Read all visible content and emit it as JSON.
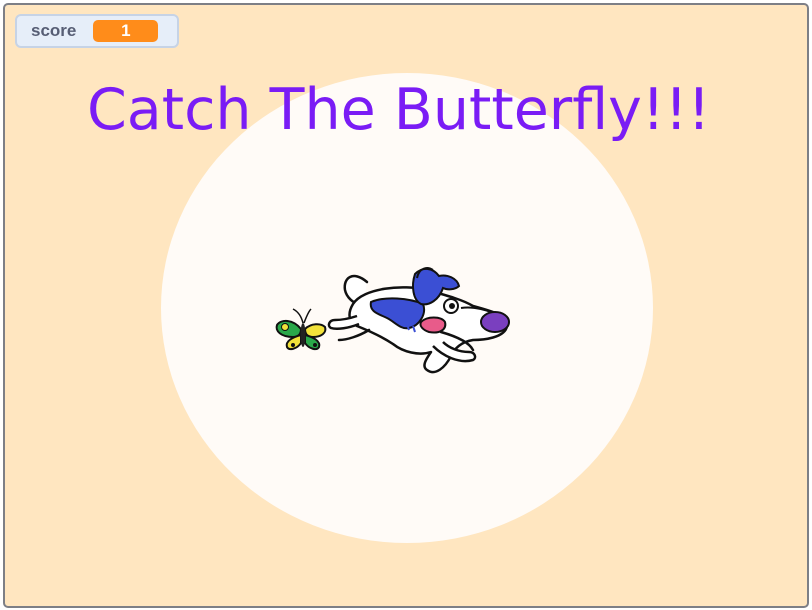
{
  "score_monitor": {
    "label": "score",
    "value": "1"
  },
  "title": "Catch The Butterfly!!!",
  "sprites": {
    "dog": "dog-sprite",
    "butterfly": "butterfly-sprite"
  },
  "colors": {
    "stage_background": "#ffe6c0",
    "backdrop_circle": "#fffbf7",
    "title_text": "#7a1cf5",
    "score_value_bg": "#ff8c1a",
    "monitor_label": "#575e75"
  }
}
